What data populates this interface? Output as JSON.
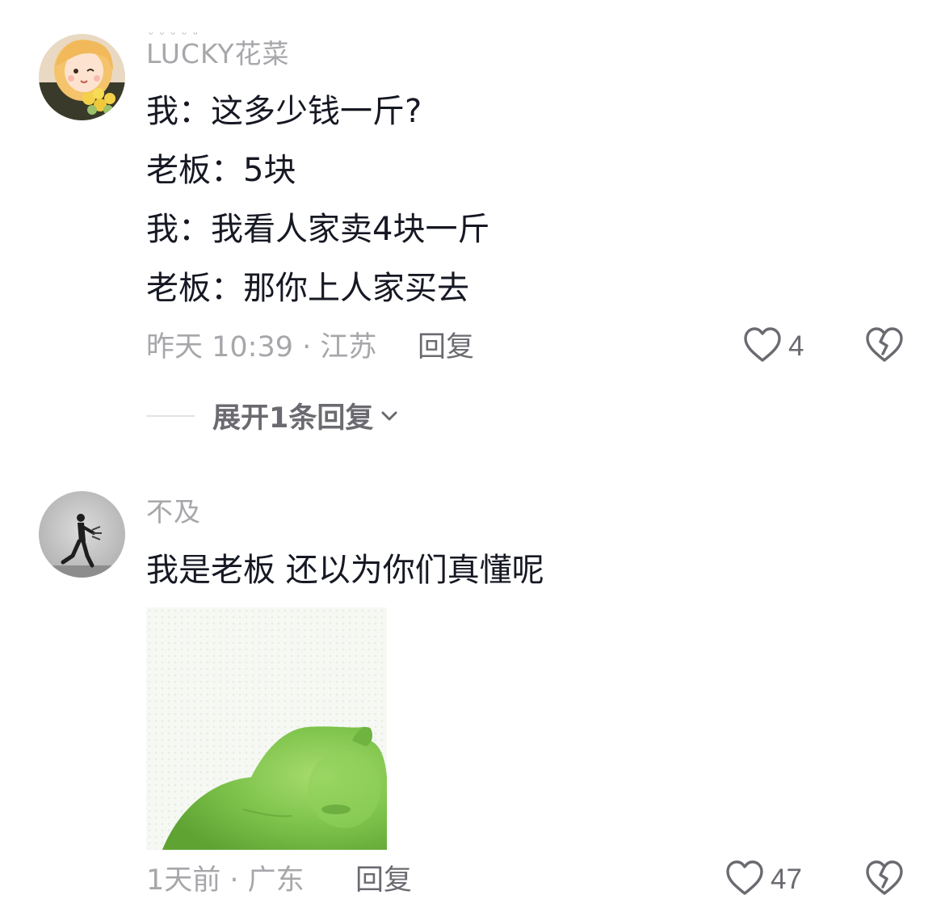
{
  "comments": [
    {
      "username": "LUCKY花菜",
      "username_dots": "ᵕᵕᵕᵕᵕ",
      "lines": [
        "我：这多少钱一斤?",
        "老板：5块",
        "我：我看人家卖4块一斤",
        "老板：那你上人家买去"
      ],
      "meta": "昨天 10:39 · 江苏",
      "reply_label": "回复",
      "likes": "4",
      "expand_label": "展开1条回复"
    },
    {
      "username": "不及",
      "lines": [
        "我是老板  还以为你们真懂呢"
      ],
      "meta": "1天前 · 广东",
      "reply_label": "回复",
      "likes": "47"
    }
  ],
  "icons": {
    "like": "heart-outline-icon",
    "dislike": "broken-heart-icon",
    "expand": "chevron-down-icon"
  },
  "colors": {
    "text": "#161823",
    "muted": "#a7a7ab",
    "action": "#6a6a70",
    "sticker_green": "#7cc24a"
  }
}
